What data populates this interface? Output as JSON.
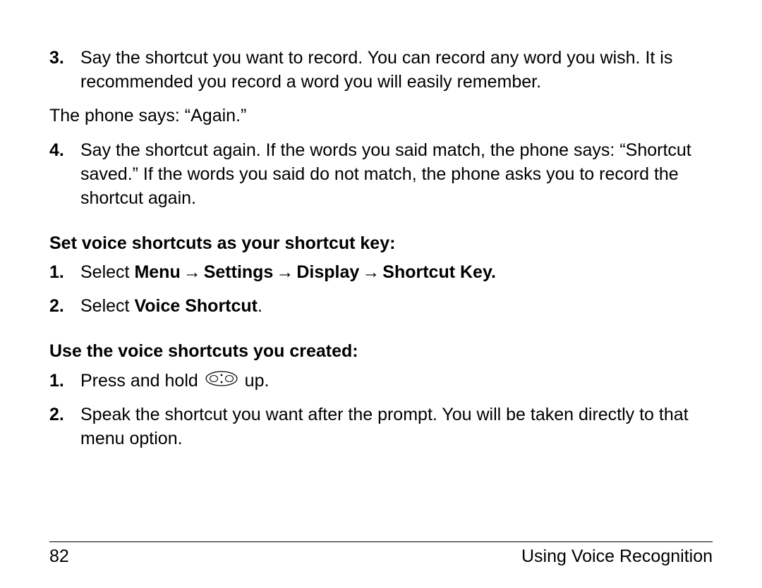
{
  "items_a": [
    {
      "num": "3.",
      "text": "Say the shortcut you want to record. You can record any word you wish. It is recommended you record a word you will easily remember."
    }
  ],
  "phone_says": "The phone says: “Again.”",
  "items_b": [
    {
      "num": "4.",
      "text": "Say the shortcut again. If the words you said match, the phone says: “Shortcut saved.” If the words you said do not match, the phone asks you to record the shortcut again."
    }
  ],
  "heading_1": "Set voice shortcuts as your shortcut key:",
  "section1": {
    "item1_num": "1.",
    "item1_prefix": "Select ",
    "menu_path": [
      "Menu",
      "Settings",
      "Display",
      "Shortcut Key."
    ],
    "item2_num": "2.",
    "item2_prefix": "Select ",
    "item2_bold": "Voice Shortcut",
    "item2_suffix": "."
  },
  "heading_2": "Use the voice shortcuts you created:",
  "section2": {
    "item1_num": "1.",
    "item1_before": "Press and hold ",
    "item1_after": " up.",
    "item2_num": "2.",
    "item2_text": "Speak the shortcut you want after the prompt. You will be taken directly to that menu option."
  },
  "footer": {
    "page_number": "82",
    "section": "Using Voice Recognition"
  },
  "arrow_glyph": "→"
}
